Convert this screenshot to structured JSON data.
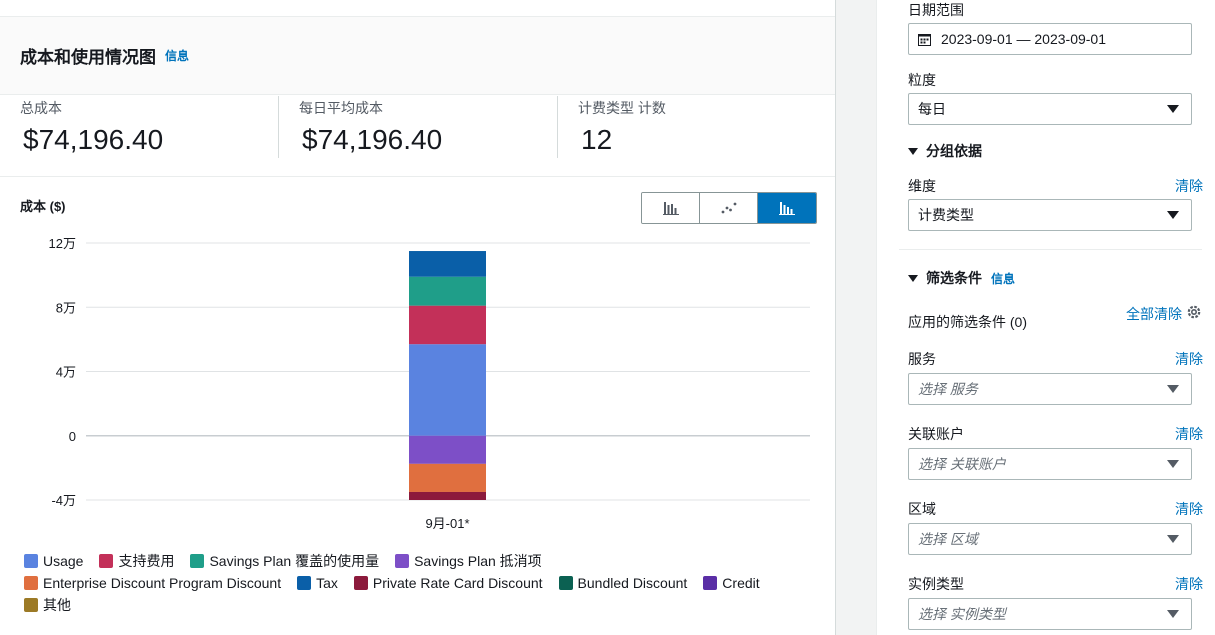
{
  "card": {
    "title": "成本和使用情况图",
    "info": "信息"
  },
  "metrics": [
    {
      "label": "总成本",
      "value": "$74,196.40"
    },
    {
      "label": "每日平均成本",
      "value": "$74,196.40"
    },
    {
      "label": "计费类型 计数",
      "value": "12"
    }
  ],
  "chart_controls": {
    "icons": [
      "bar-chart-icon",
      "line-chart-icon",
      "stacked-bar-chart-icon"
    ],
    "active": 2
  },
  "chart_data": {
    "type": "bar",
    "stacked": true,
    "ylabel": "成本 ($)",
    "categories": [
      "9月-01*"
    ],
    "yticks": [
      {
        "value": 120000,
        "label": "12万"
      },
      {
        "value": 80000,
        "label": "8万"
      },
      {
        "value": 40000,
        "label": "4万"
      },
      {
        "value": 0,
        "label": "0"
      },
      {
        "value": -40000,
        "label": "-4万"
      }
    ],
    "ylim": [
      -40000,
      120000
    ],
    "grid": true,
    "legend_position": "bottom",
    "series": [
      {
        "name": "Usage",
        "color": "#5a83e0",
        "values": [
          57000
        ]
      },
      {
        "name": "支持费用",
        "color": "#c33059",
        "values": [
          24000
        ]
      },
      {
        "name": "Savings Plan 覆盖的使用量",
        "color": "#1f9e89",
        "values": [
          18000
        ]
      },
      {
        "name": "Savings Plan 抵消项",
        "color": "#7d4fc7",
        "values": [
          -17500
        ]
      },
      {
        "name": "Enterprise Discount Program Discount",
        "color": "#e06f3f",
        "values": [
          -17500
        ]
      },
      {
        "name": "Tax",
        "color": "#0a5fa8",
        "values": [
          16000
        ]
      },
      {
        "name": "Private Rate Card Discount",
        "color": "#8c1a3c",
        "values": [
          -5000
        ]
      },
      {
        "name": "Bundled Discount",
        "color": "#0b6152",
        "values": [
          0
        ]
      },
      {
        "name": "Credit",
        "color": "#5a2ea6",
        "values": [
          0
        ]
      },
      {
        "name": "其他",
        "color": "#9c7a26",
        "values": [
          0
        ]
      }
    ]
  },
  "panel": {
    "date_range": {
      "label": "日期范围",
      "value": "2023-09-01 — 2023-09-01"
    },
    "granularity": {
      "label": "粒度",
      "value": "每日"
    },
    "group_by": {
      "title": "分组依据",
      "dimension_label": "维度",
      "clear": "清除",
      "dimension_value": "计费类型"
    },
    "filters": {
      "title": "筛选条件",
      "info": "信息",
      "applied": "应用的筛选条件 (0)",
      "clear_all": "全部清除",
      "items": [
        {
          "label": "服务",
          "clear": "清除",
          "placeholder": "选择 服务"
        },
        {
          "label": "关联账户",
          "clear": "清除",
          "placeholder": "选择 关联账户"
        },
        {
          "label": "区域",
          "clear": "清除",
          "placeholder": "选择 区域"
        },
        {
          "label": "实例类型",
          "clear": "清除",
          "placeholder": "选择 实例类型"
        }
      ]
    }
  }
}
